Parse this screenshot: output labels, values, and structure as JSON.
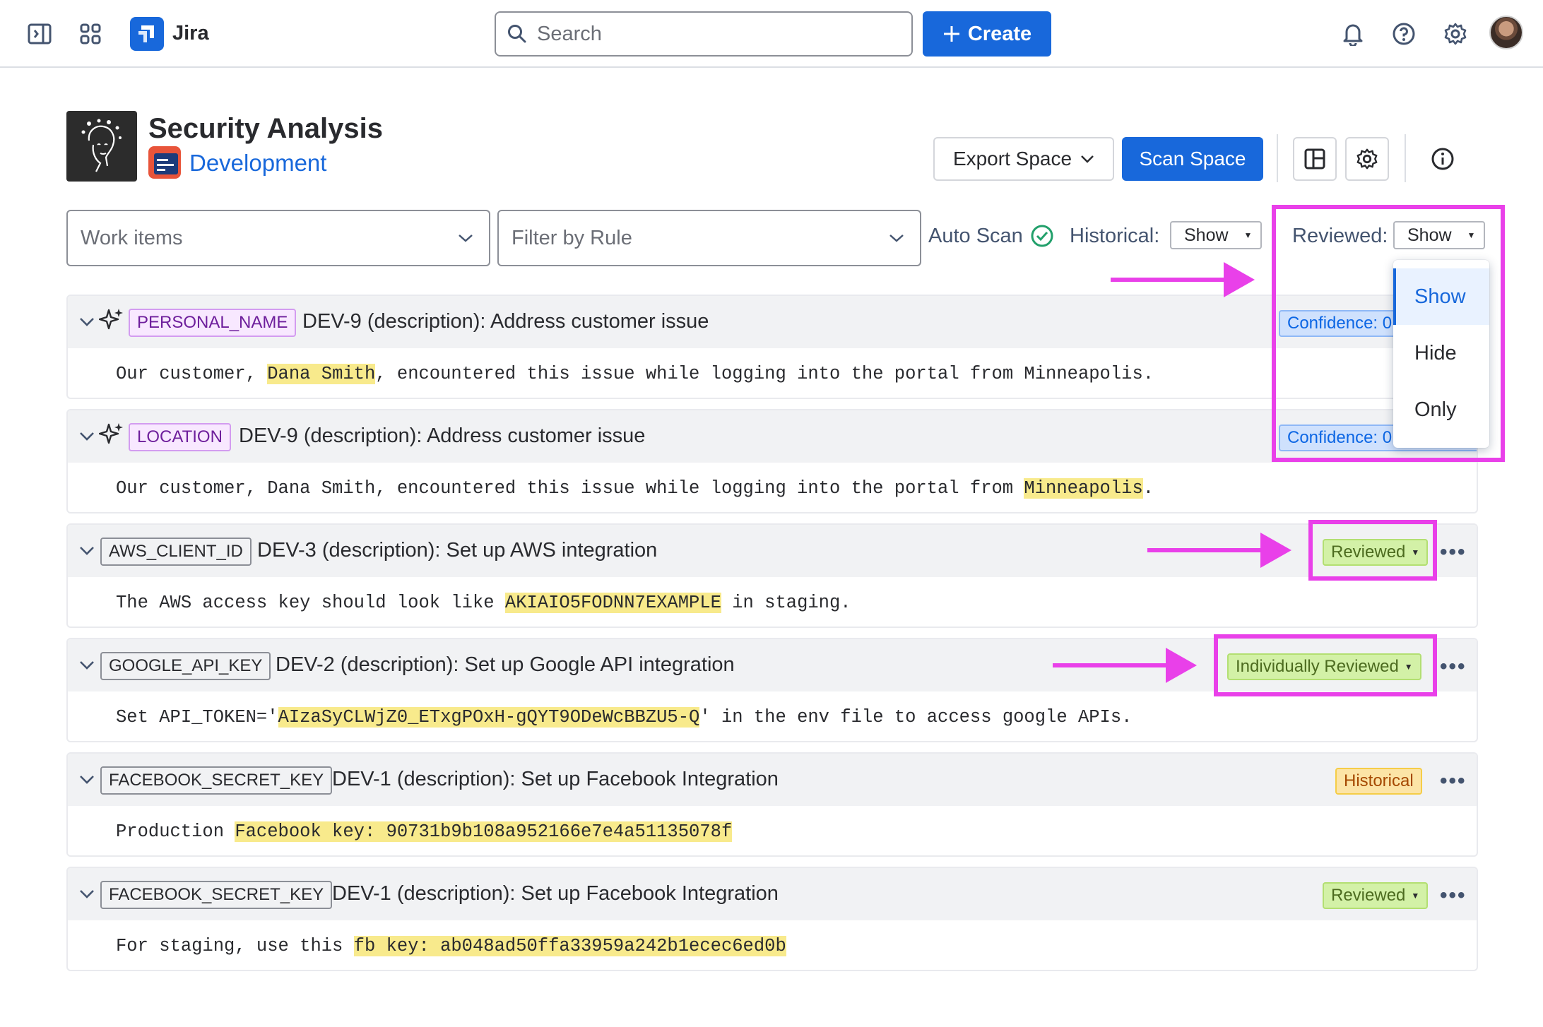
{
  "nav": {
    "app_name": "Jira",
    "search_placeholder": "Search",
    "create_label": "Create",
    "icons": [
      "sidebar-toggle-icon",
      "app-switcher-icon",
      "jira-logo-icon",
      "search-icon",
      "bell-icon",
      "help-icon",
      "gear-icon",
      "avatar"
    ]
  },
  "header": {
    "title": "Security Analysis",
    "project": "Development",
    "export_label": "Export Space",
    "scan_label": "Scan Space"
  },
  "filters": {
    "work_items_placeholder": "Work items",
    "rule_placeholder": "Filter by Rule",
    "auto_scan_label": "Auto Scan",
    "historical_label": "Historical:",
    "historical_value": "Show",
    "reviewed_label": "Reviewed:",
    "reviewed_value": "Show"
  },
  "dropdown": {
    "options": [
      "Show",
      "Hide",
      "Only"
    ],
    "selected": "Show"
  },
  "rows": [
    {
      "tag": "PERSONAL_NAME",
      "title": "DEV-9 (description): Address customer issue",
      "status": "Confidence: 0",
      "text_before": "Our customer, ",
      "highlight": "Dana Smith",
      "text_after": ", encountered this issue while logging into the portal from Minneapolis."
    },
    {
      "tag": "LOCATION",
      "title": "DEV-9 (description): Address customer issue",
      "status": "Confidence: 0.",
      "text_before": "Our customer, Dana Smith, encountered this issue while logging into the portal from ",
      "highlight": "Minneapolis",
      "text_after": "."
    },
    {
      "tag": "AWS_CLIENT_ID",
      "title": "DEV-3 (description): Set up AWS integration",
      "status": "Reviewed",
      "text_before": "The AWS access key should look like ",
      "highlight": "AKIAIO5FODNN7EXAMPLE",
      "text_after": " in staging."
    },
    {
      "tag": "GOOGLE_API_KEY",
      "title": "DEV-2 (description): Set up Google API integration",
      "status": "Individually Reviewed",
      "text_before": "Set API_TOKEN='",
      "highlight": "AIzaSyCLWjZ0_ETxgPOxH-gQYT9ODeWcBBZU5-Q",
      "text_after": "' in the env file to access google APIs."
    },
    {
      "tag": "FACEBOOK_SECRET_KEY",
      "title": "DEV-1 (description): Set up Facebook Integration",
      "status": "Historical",
      "text_before": "Production ",
      "highlight": "Facebook key: 90731b9b108a952166e7e4a51135078f",
      "text_after": ""
    },
    {
      "tag": "FACEBOOK_SECRET_KEY",
      "title": "DEV-1 (description): Set up Facebook Integration",
      "status": "Reviewed",
      "text_before": "For staging, use this ",
      "highlight": "fb key: ab048ad50ffa33959a242b1ecec6ed0b",
      "text_after": ""
    }
  ],
  "colors": {
    "brand": "#1868db",
    "annotation": "#e940e9",
    "highlight": "#f8ea8c",
    "reviewed": "#d3f1a7",
    "historical": "#fce4a6"
  }
}
